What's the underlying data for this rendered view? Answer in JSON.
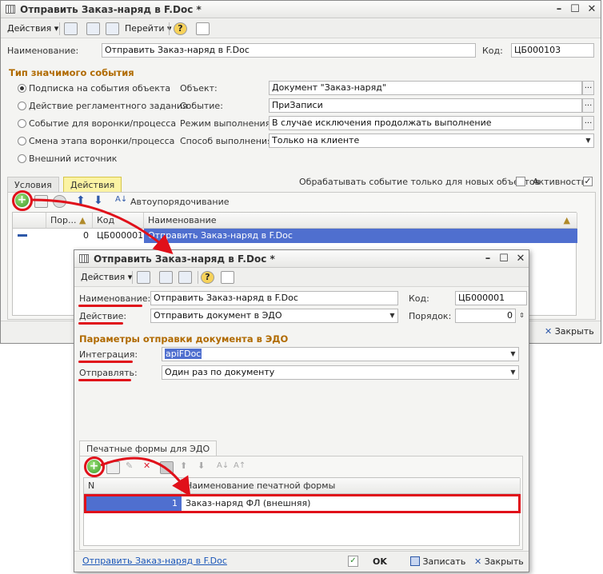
{
  "main": {
    "title": "Отправить Заказ-наряд в F.Doc *",
    "toolbar": {
      "actions": "Действия",
      "goto": "Перейти"
    },
    "name_label": "Наименование:",
    "name_value": "Отправить Заказ-наряд в F.Doc",
    "code_label": "Код:",
    "code_value": "ЦБ000103",
    "event_type_title": "Тип значимого события",
    "radios": [
      "Подписка на события объекта",
      "Действие регламентного задания",
      "Событие для воронки/процесса",
      "Смена этапа воронки/процесса",
      "Внешний источник"
    ],
    "object_label": "Объект:",
    "object_value": "Документ \"Заказ-наряд\"",
    "event_label": "Событие:",
    "event_value": "ПриЗаписи",
    "mode_label": "Режим выполнения:",
    "mode_value": "В случае исключения продолжать выполнение",
    "method_label": "Способ выполнения:",
    "method_value": "Только на клиенте",
    "tabs": [
      "Условия",
      "Действия"
    ],
    "new_only_label": "Обрабатывать событие только для новых объектов",
    "active_label": "Активность",
    "active_check": "✓",
    "auto_order": "Автоупорядочивание",
    "grid_headers": [
      "Пор...",
      "Код",
      "Наименование"
    ],
    "row": {
      "order": "0",
      "code": "ЦБ000001",
      "name": "Отправить Заказ-наряд в F.Doc"
    },
    "close_label": "Закрыть"
  },
  "dialog": {
    "title": "Отправить Заказ-наряд в F.Doc *",
    "toolbar": {
      "actions": "Действия"
    },
    "name_label": "Наименование:",
    "name_value": "Отправить Заказ-наряд в F.Doc",
    "code_label": "Код:",
    "code_value": "ЦБ000001",
    "action_label": "Действие:",
    "action_value": "Отправить документ в ЭДО",
    "order_label": "Порядок:",
    "order_value": "0",
    "params_title": "Параметры отправки документа в ЭДО",
    "integration_label": "Интеграция:",
    "integration_value": "apiFDoc",
    "send_label": "Отправлять:",
    "send_value": "Один раз по документу",
    "print_tab": "Печатные формы для ЭДО",
    "grid_headers": [
      "N",
      "Наименование печатной формы"
    ],
    "row": {
      "n": "1",
      "name": "Заказ-наряд ФЛ (внешняя)"
    },
    "footer_link": "Отправить Заказ-наряд в F.Doc",
    "ok_label": "OK",
    "save_label": "Записать",
    "close_label": "Закрыть"
  },
  "colors": {
    "accent_red": "#e0101a",
    "section_orange": "#b06a00",
    "selection_blue": "#4f6fcf"
  }
}
